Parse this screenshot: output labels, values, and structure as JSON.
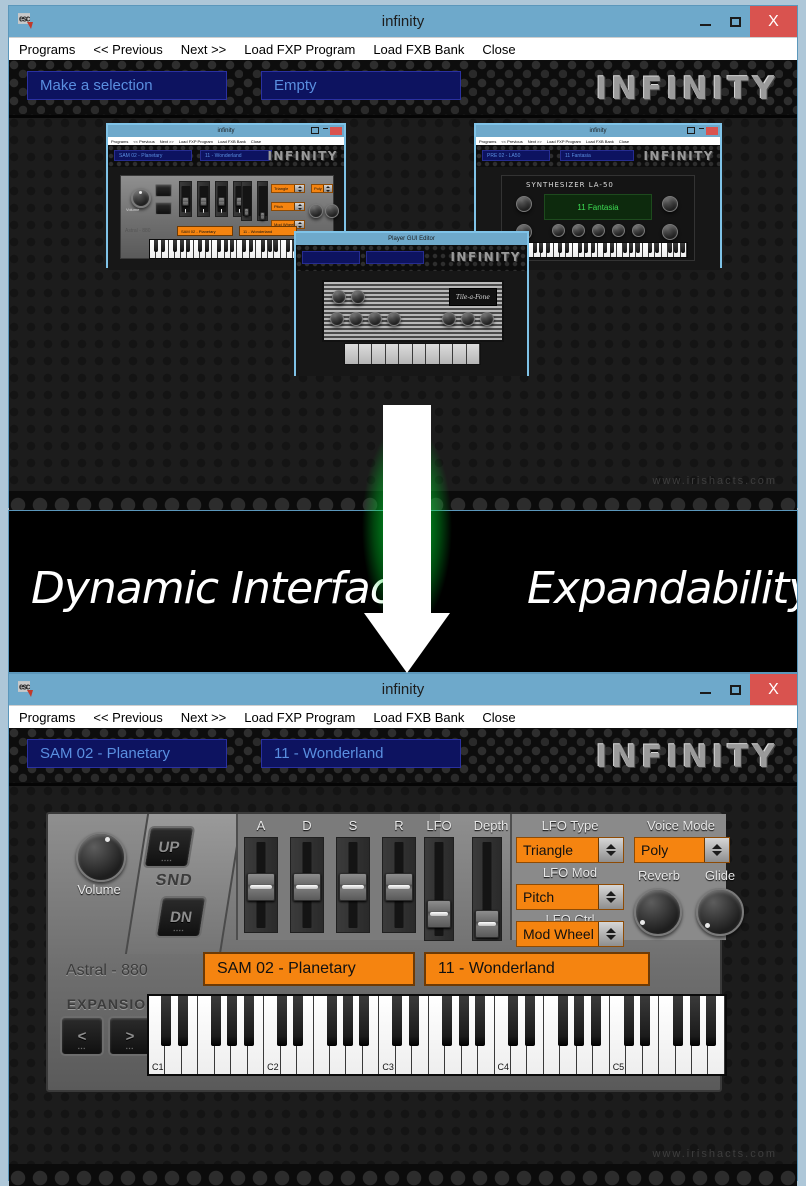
{
  "top_window": {
    "title": "infinity",
    "icon": "esc-icon",
    "menu": [
      "Programs",
      "<< Previous",
      "Next >>",
      "Load FXP Program",
      "Load FXB Bank",
      "Close"
    ],
    "controls": {
      "minimize": "minimize-button",
      "maximize": "maximize-button",
      "close": "X"
    },
    "brand": "INFINITY",
    "field_bank": "Make a selection",
    "field_program": "Empty",
    "watermark": "www.irishacts.com"
  },
  "nested_windows": [
    {
      "title": "infinity",
      "menu": [
        "Programs",
        "<< Previous",
        "Next >>",
        "Load FXP Program",
        "Load FXB Bank",
        "Close"
      ],
      "brand": "INFINITY",
      "field_bank": "SAM 02 - Planetary",
      "field_program": "11 - Wonderland",
      "instrument": "Astral - 880"
    },
    {
      "title": "infinity",
      "menu": [
        "Programs",
        "<< Previous",
        "Next >>",
        "Load FXP Program",
        "Load FXB Bank",
        "Close"
      ],
      "brand": "INFINITY",
      "field_bank": "PRE 02 - LA50",
      "field_program": "11 Fantasia",
      "instrument": "SYNTHESIZER LA-50",
      "lcd_text": "11 Fantasia"
    },
    {
      "title": "Player GUI Editor",
      "brand": "INFINITY",
      "field_bank": "",
      "field_program": "",
      "instrument": "Tile-a-Fone"
    }
  ],
  "banner": {
    "left_text": "Dynamic Interface",
    "right_text": "Expandability",
    "arrow": "down-arrow",
    "glow_color": "#00ff3c"
  },
  "bottom_window": {
    "title": "infinity",
    "icon": "esc-icon",
    "menu": [
      "Programs",
      "<< Previous",
      "Next >>",
      "Load FXP Program",
      "Load FXB Bank",
      "Close"
    ],
    "controls": {
      "minimize": "minimize-button",
      "maximize": "maximize-button",
      "close": "X"
    },
    "brand": "INFINITY",
    "field_bank": "SAM 02 - Planetary",
    "field_program": "11 - Wonderland",
    "watermark": "www.irishacts.com",
    "synth": {
      "model": "Astral - 880",
      "volume_label": "Volume",
      "snd_label": "SND",
      "snd_up": "UP",
      "snd_dn": "DN",
      "expansion_label": "EXPANSION",
      "expansion_prev": "<",
      "expansion_next": ">",
      "sliders": [
        {
          "label": "A",
          "value": 50
        },
        {
          "label": "D",
          "value": 50
        },
        {
          "label": "S",
          "value": 50
        },
        {
          "label": "R",
          "value": 50
        },
        {
          "label": "LFO",
          "value": 22
        },
        {
          "label": "Depth",
          "value": 15
        }
      ],
      "dropdowns": [
        {
          "label": "LFO Type",
          "value": "Triangle"
        },
        {
          "label": "LFO Mod",
          "value": "Pitch"
        },
        {
          "label": "LFO Ctrl",
          "value": "Mod Wheel"
        },
        {
          "label": "Voice Mode",
          "value": "Poly"
        }
      ],
      "knobs": [
        {
          "label": "Reverb",
          "value": 10
        },
        {
          "label": "Glide",
          "value": 5
        }
      ],
      "display_bank": "SAM 02 - Planetary",
      "display_program": "11 - Wonderland",
      "keyboard_octaves": [
        "C1",
        "C2",
        "C3",
        "C4",
        "C5"
      ]
    }
  },
  "colors": {
    "titlebar": "#6ea9cb",
    "close_red": "#d9534f",
    "orange": "#f58410",
    "field_navy": "#0d1360",
    "field_text": "#5a8fe0",
    "glow_green": "#00ff3c"
  }
}
